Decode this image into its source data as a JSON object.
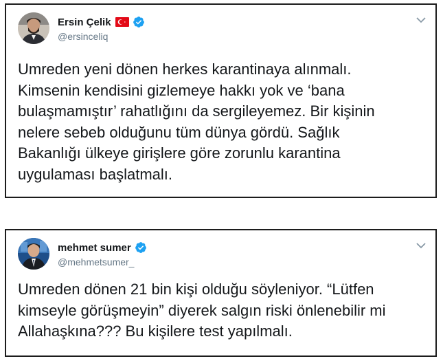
{
  "tweets": [
    {
      "author_name": "Ersin Çelik",
      "handle": "@ersinceliq",
      "has_flag": true,
      "verified": true,
      "text": "Umreden yeni dönen herkes karantinaya alınmalı.\nKimsenin kendisini gizlemeye hakkı yok ve ‘bana\nbulaşmamıştır’ rahatlığını da sergileyemez. Bir kişinin\nnelere sebeb olduğunu tüm dünya gördü. Sağlık\nBakanlığı ülkeye girişlere göre zorunlu karantina\nuygulaması başlatmalı."
    },
    {
      "author_name": "mehmet sumer",
      "handle": "@mehmetsumer_",
      "has_flag": false,
      "verified": true,
      "text": "Umreden dönen 21 bin kişi olduğu söyleniyor. “Lütfen\nkimseyle görüşmeyin” diyerek salgın riski önlenebilir mi\nAllahaşkına??? Bu kişilere test yapılmalı."
    }
  ],
  "colors": {
    "verified_blue": "#1da1f2",
    "handle_gray": "#657786",
    "text": "#14171a",
    "flag_red": "#e30a17"
  },
  "icons": [
    "turkey-flag-icon",
    "verified-badge-icon",
    "chevron-down-icon"
  ]
}
